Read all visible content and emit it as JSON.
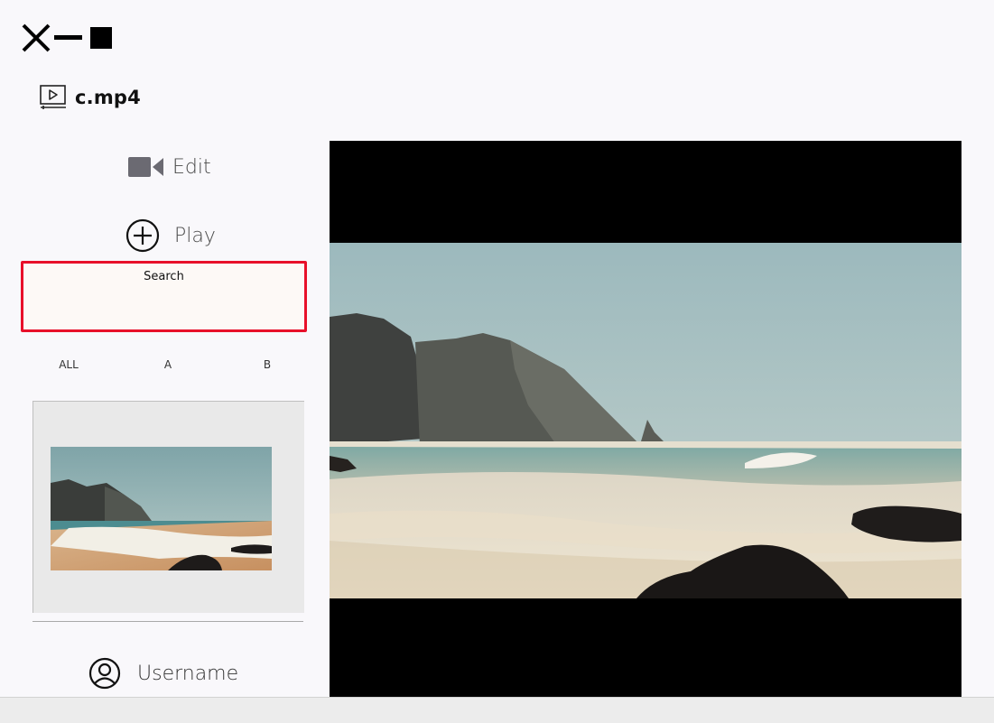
{
  "window": {
    "controls": [
      "close-icon",
      "minimize-icon",
      "maximize-icon"
    ]
  },
  "file": {
    "name": "c.mp4",
    "icon": "video-file-icon"
  },
  "nav": {
    "edit": {
      "label": "Edit",
      "icon": "video-camera-icon"
    },
    "play": {
      "label": "Play",
      "icon": "plus-circle-icon"
    }
  },
  "search": {
    "value": "Search",
    "highlight_color": "#e8102a"
  },
  "filters": [
    {
      "label": "ALL"
    },
    {
      "label": "A"
    },
    {
      "label": "B"
    }
  ],
  "user": {
    "label": "Username",
    "icon": "user-circle-icon"
  },
  "colors": {
    "background": "#f9f8fb",
    "accent": "#e8102a",
    "player_bg": "#000000"
  }
}
